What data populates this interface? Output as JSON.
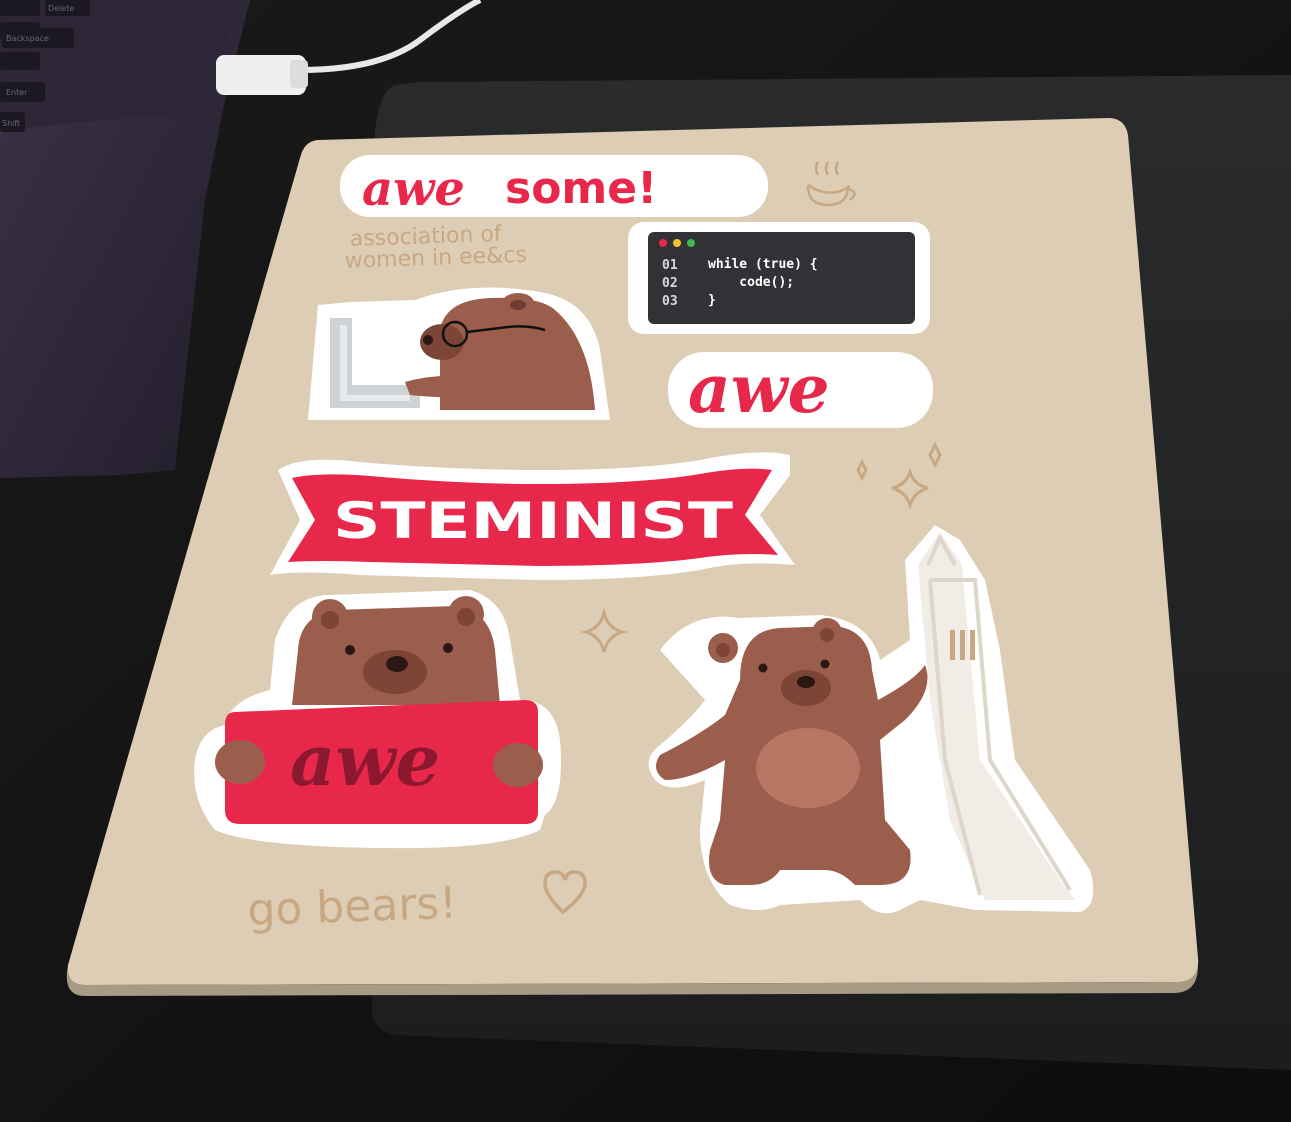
{
  "sheet": {
    "awesome": {
      "part1": "awe",
      "part2": "some!"
    },
    "subtitle_line1": "association of",
    "subtitle_line2": "women in ee&cs",
    "code": {
      "lines": [
        {
          "num": "01",
          "text": "while (true) {"
        },
        {
          "num": "02",
          "text": "    code();"
        },
        {
          "num": "03",
          "text": "}"
        }
      ]
    },
    "awe_sticker": "awe",
    "banner": "STEMINIST",
    "sign": "awe",
    "footer": "go bears!",
    "colors": {
      "sheet": "#ddcdb4",
      "red": "#e8284a",
      "bear": "#9b5e4c",
      "bear_dark": "#6e3c30",
      "tan_text": "#c8a883",
      "terminal": "#303236"
    }
  },
  "laptop": {
    "keys": [
      "Delete",
      "Backspace",
      "Enter",
      "Shift"
    ]
  },
  "icons": [
    "coffee-cup-icon",
    "sparkle-icon",
    "heart-icon"
  ]
}
